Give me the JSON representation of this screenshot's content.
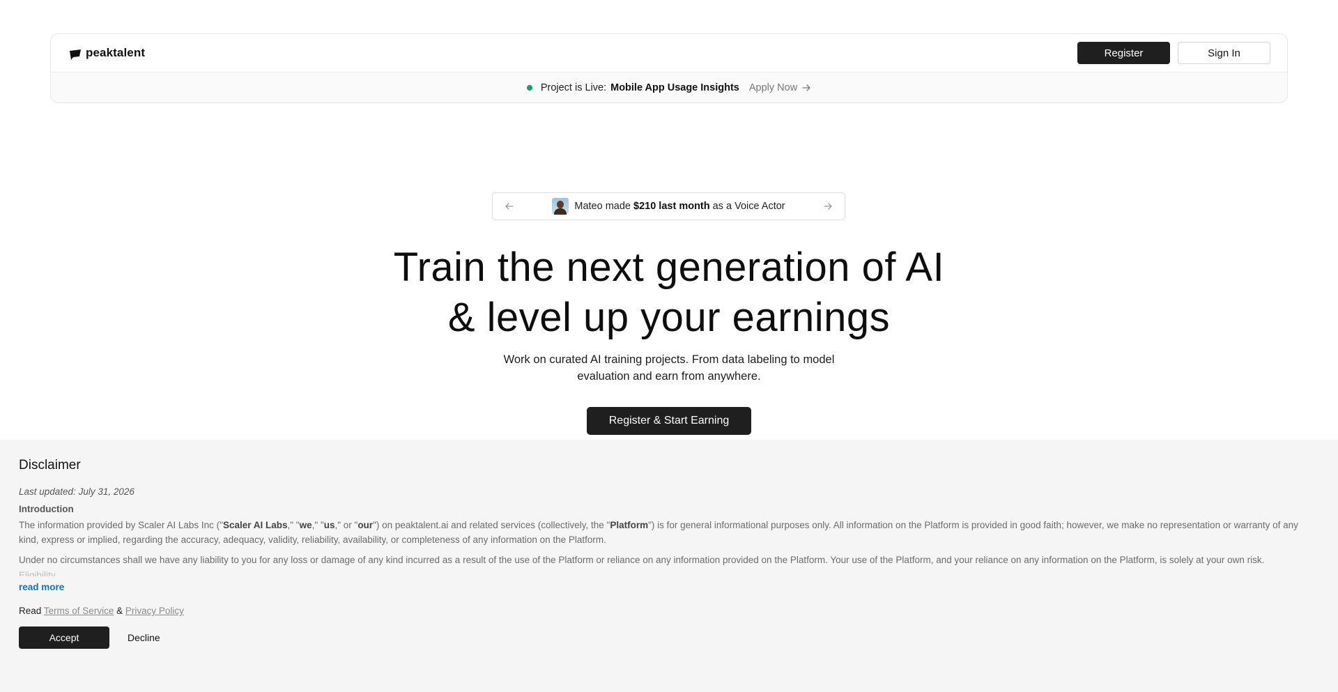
{
  "header": {
    "brand_name": "peaktalent",
    "register_label": "Register",
    "signin_label": "Sign In"
  },
  "announcement": {
    "prefix": "Project is Live:",
    "project_name": "Mobile App Usage Insights",
    "apply_label": "Apply Now",
    "dot_color": "#1a9b67"
  },
  "ticker": {
    "name_text": "Mateo made",
    "amount_text": "$210 last month",
    "suffix_text": "as a Voice Actor"
  },
  "hero": {
    "title_line1": "Train the next generation of AI",
    "title_line2": "& level up your earnings",
    "subtitle_line1": "Work on curated AI training projects. From data labeling to model",
    "subtitle_line2": "evaluation and earn from anywhere.",
    "cta_label": "Register & Start Earning"
  },
  "disclaimer": {
    "title": "Disclaimer",
    "last_updated": "Last updated: July 31, 2026",
    "section_intro": "Introduction",
    "p1_a": "The information provided by Scaler AI Labs Inc (\"",
    "p1_b": "Scaler AI Labs",
    "p1_c": ",\" \"",
    "p1_d": "we",
    "p1_e": ",\" \"",
    "p1_f": "us",
    "p1_g": ",\" or \"",
    "p1_h": "our",
    "p1_i": "\") on peaktalent.ai and related services (collectively, the \"",
    "p1_j": "Platform",
    "p1_k": "\") is for general informational purposes only. All information on the Platform is provided in good faith; however, we make no representation or warranty of any kind, express or implied, regarding the accuracy, adequacy, validity, reliability, availability, or completeness of any information on the Platform.",
    "p2": "Under no circumstances shall we have any liability to you for any loss or damage of any kind incurred as a result of the use of the Platform or reliance on any information provided on the Platform. Your use of the Platform, and your reliance on any information on the Platform, is solely at your own risk.",
    "faded_heading": "Eligibility",
    "read_more": "read more",
    "read_prefix": "Read",
    "terms_label": "Terms of Service",
    "and_label": "&",
    "privacy_label": "Privacy Policy",
    "accept_label": "Accept",
    "decline_label": "Decline"
  },
  "icons": {
    "logo": "peaktalent-logo-icon",
    "apply_arrow": "arrow-right-icon",
    "prev": "arrow-left-icon",
    "next": "arrow-right-icon"
  }
}
